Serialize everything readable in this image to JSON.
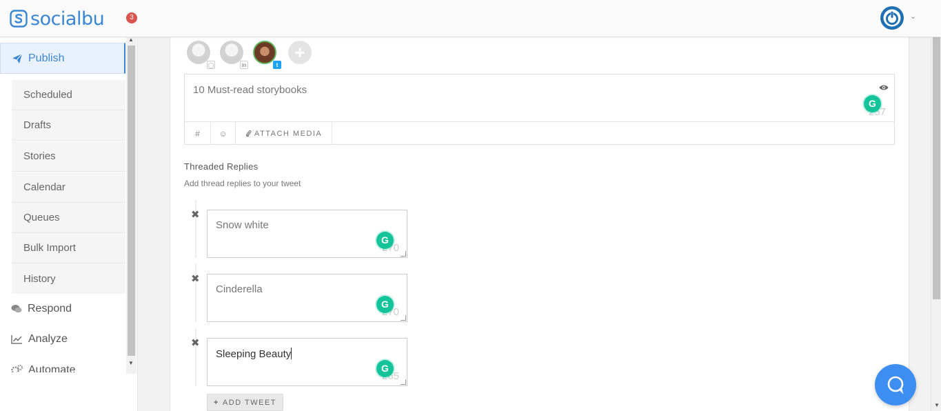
{
  "app": {
    "logo_text": "socialbu",
    "notification_count": "3",
    "brand_color": "#3a86d6"
  },
  "sidebar": {
    "publish": "Publish",
    "sub_items": [
      "Scheduled",
      "Drafts",
      "Stories",
      "Calendar",
      "Queues",
      "Bulk Import",
      "History"
    ],
    "respond": "Respond",
    "analyze": "Analyze",
    "automate": "Automate"
  },
  "accounts": [
    {
      "network": "instagram",
      "selected": false
    },
    {
      "network": "linkedin",
      "selected": false
    },
    {
      "network": "twitter",
      "selected": true
    }
  ],
  "compose": {
    "text": "10 Must-read storybooks",
    "char_counter": "257",
    "toolbar": {
      "hashtag": "#",
      "emoji": "☺",
      "attach_media": "ATTACH MEDIA"
    }
  },
  "threaded": {
    "title": "Threaded Replies",
    "subtitle": "Add thread replies to your tweet",
    "replies": [
      {
        "text": "Snow white",
        "counter": "270"
      },
      {
        "text": "Cinderella",
        "counter": "270"
      },
      {
        "text": "Sleeping Beauty",
        "counter": "265"
      }
    ],
    "add_tweet": "ADD TWEET"
  }
}
